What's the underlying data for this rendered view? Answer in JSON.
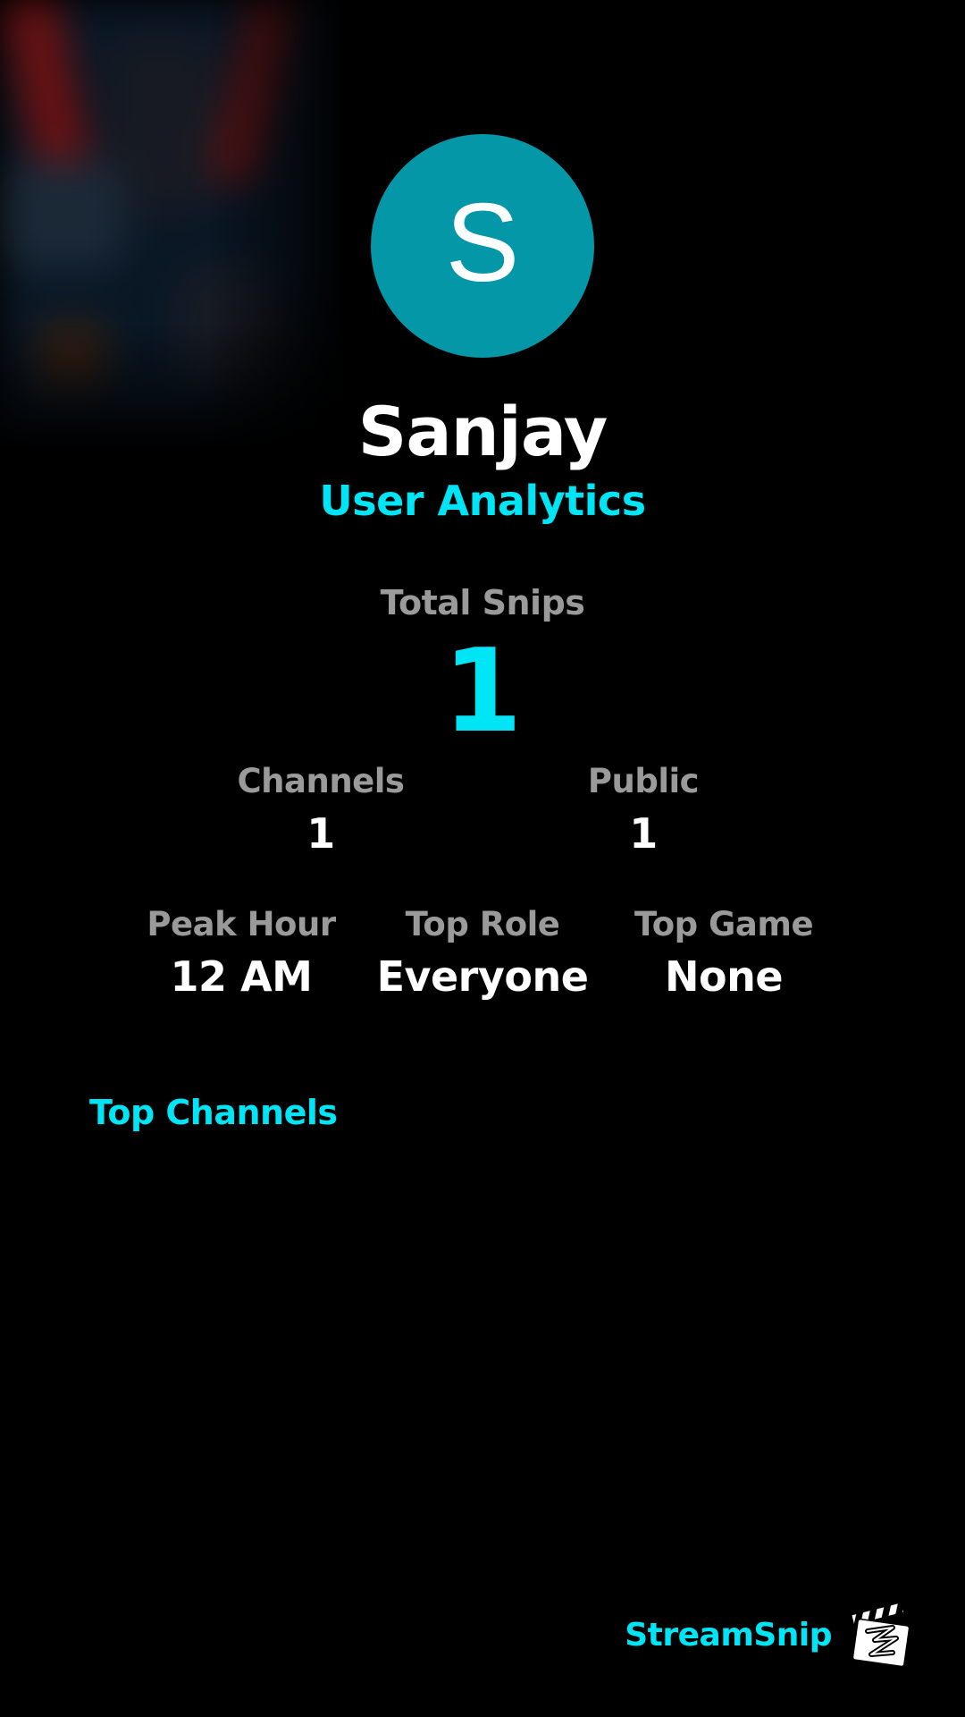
{
  "profile": {
    "avatar_initial": "S",
    "name": "Sanjay",
    "subtitle": "User Analytics"
  },
  "stats": {
    "total_snips_label": "Total Snips",
    "total_snips_value": "1",
    "channels_label": "Channels",
    "channels_value": "1",
    "public_label": "Public",
    "public_value": "1",
    "peak_hour_label": "Peak Hour",
    "peak_hour_value": "12 AM",
    "top_role_label": "Top Role",
    "top_role_value": "Everyone",
    "top_game_label": "Top Game",
    "top_game_value": "None"
  },
  "sections": {
    "top_channels_title": "Top Channels"
  },
  "brand": {
    "name": "StreamSnip",
    "logo_icon": "clapperboard-logo-icon"
  },
  "colors": {
    "accent": "#00e5f5",
    "avatar_bg": "#0397a8",
    "label": "#9a9a9a",
    "background": "#000000"
  }
}
